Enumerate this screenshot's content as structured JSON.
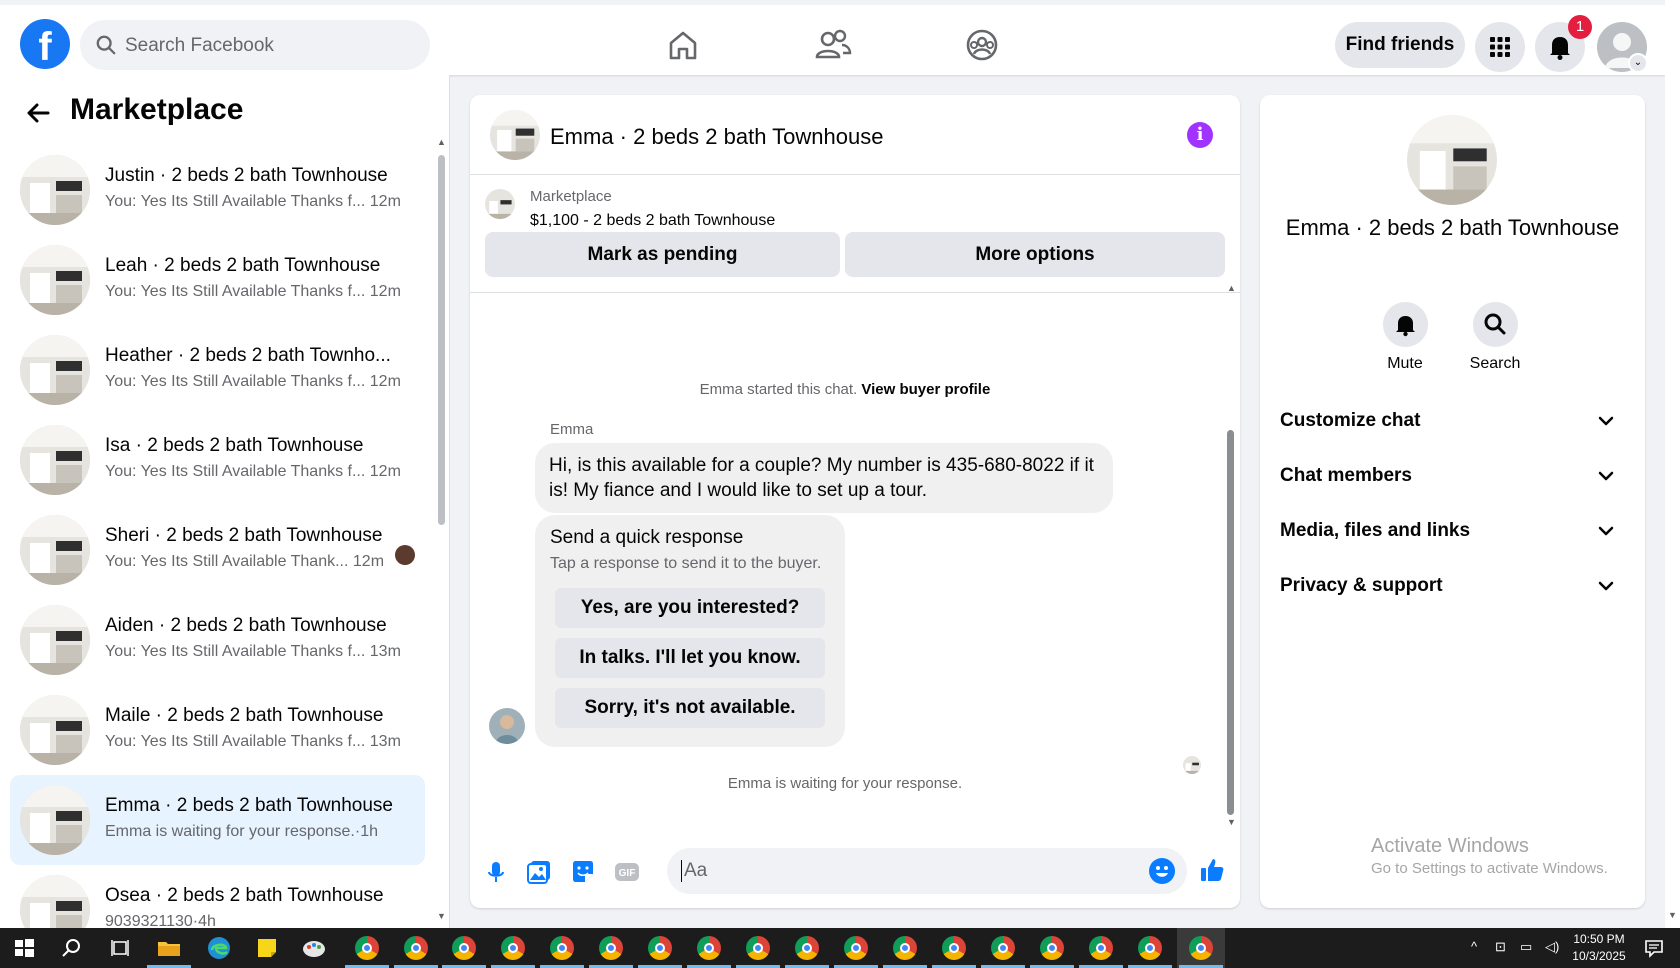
{
  "topbar": {
    "logo": "f",
    "search_placeholder": "Search Facebook",
    "find_friends": "Find friends",
    "notification_count": "1",
    "nav_icons": [
      "home-icon",
      "friends-icon",
      "groups-icon"
    ]
  },
  "left": {
    "title": "Marketplace",
    "conversations": [
      {
        "title": "Justin · 2 beds 2 bath Townhouse",
        "snippet": "You: Yes Its Still Available Thanks f...",
        "time": "12m"
      },
      {
        "title": "Leah · 2 beds 2 bath Townhouse",
        "snippet": "You: Yes Its Still Available Thanks f...",
        "time": "12m"
      },
      {
        "title": "Heather · 2 beds 2 bath Townho...",
        "snippet": "You: Yes Its Still Available Thanks f...",
        "time": "12m"
      },
      {
        "title": "Isa · 2 beds 2 bath Townhouse",
        "snippet": "You: Yes Its Still Available Thanks f...",
        "time": "12m"
      },
      {
        "title": "Sheri · 2 beds 2 bath Townhouse",
        "snippet": "You: Yes Its Still Available Thank...",
        "time": "12m"
      },
      {
        "title": "Aiden · 2 beds 2 bath Townhouse",
        "snippet": "You: Yes Its Still Available Thanks f...",
        "time": "13m"
      },
      {
        "title": "Maile · 2 beds 2 bath Townhouse",
        "snippet": "You: Yes Its Still Available Thanks f...",
        "time": "13m"
      },
      {
        "title": "Emma · 2 beds 2 bath Townhouse",
        "snippet": "Emma is waiting for your response.",
        "time": "1h"
      },
      {
        "title": "Osea · 2 beds 2 bath Townhouse",
        "snippet": "9039321130",
        "time": "4h"
      }
    ]
  },
  "chat": {
    "title": "Emma · 2 beds 2 bath Townhouse",
    "info_icon": "i",
    "listing_source": "Marketplace",
    "listing_price_title": "$1,100 - 2 beds 2 bath Townhouse",
    "mark_pending": "Mark as pending",
    "more_options": "More options",
    "started_text": "Emma started this chat.",
    "view_profile": "View buyer profile",
    "sender": "Emma",
    "message": "Hi, is this available for a couple? My number is 435-680-8022 if it is! My fiance and I would like to set up a tour.",
    "quick_title": "Send a quick response",
    "quick_subtitle": "Tap a response to send it to the buyer.",
    "quick_responses": [
      "Yes, are you interested?",
      "In talks. I'll let you know.",
      "Sorry, it's not available."
    ],
    "waiting_text": "Emma is waiting for your response.",
    "composer_placeholder": "Aa"
  },
  "right": {
    "name": "Emma · 2 beds 2 bath Townhouse",
    "mute": "Mute",
    "search": "Search",
    "sections": [
      "Customize chat",
      "Chat members",
      "Media, files and links",
      "Privacy & support"
    ]
  },
  "watermark": {
    "line1": "Activate Windows",
    "line2": "Go to Settings to activate Windows."
  },
  "taskbar": {
    "time": "10:50 PM",
    "date": "10/3/2025"
  },
  "colors": {
    "brand": "#1877f2",
    "active_conv": "#e7f3ff",
    "badge": "#e41e3f",
    "info": "#a033ff"
  }
}
